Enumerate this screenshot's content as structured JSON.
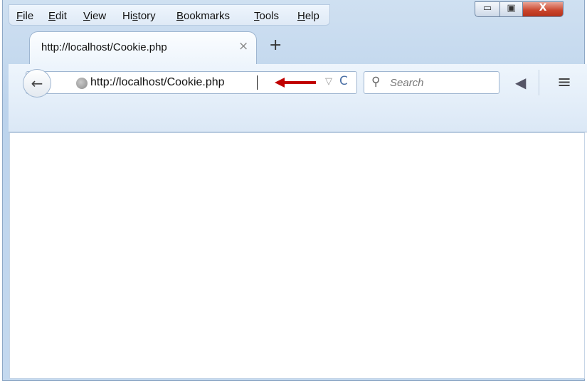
{
  "menu": {
    "items": [
      {
        "pre": "",
        "ul": "F",
        "post": "ile"
      },
      {
        "pre": "",
        "ul": "E",
        "post": "dit"
      },
      {
        "pre": "",
        "ul": "V",
        "post": "iew"
      },
      {
        "pre": "Hi",
        "ul": "s",
        "post": "tory"
      },
      {
        "pre": "",
        "ul": "B",
        "post": "ookmarks"
      },
      {
        "pre": "",
        "ul": "T",
        "post": "ools"
      },
      {
        "pre": "",
        "ul": "H",
        "post": "elp"
      }
    ]
  },
  "window_controls": {
    "minimize": "▭",
    "maximize": "▣",
    "close": "X"
  },
  "tab": {
    "title": "http://localhost/Cookie.php",
    "close": "×"
  },
  "new_tab": "+",
  "navbar": {
    "back": "←",
    "url": "http://localhost/Cookie.php",
    "dropdown": "▽",
    "reload": "C",
    "search_placeholder": "Search",
    "search_icon": "⚲",
    "send_icon": "◀",
    "menu_icon": "≡"
  },
  "colors": {
    "arrow": "#c00000",
    "frame": "#bcd3ec"
  }
}
